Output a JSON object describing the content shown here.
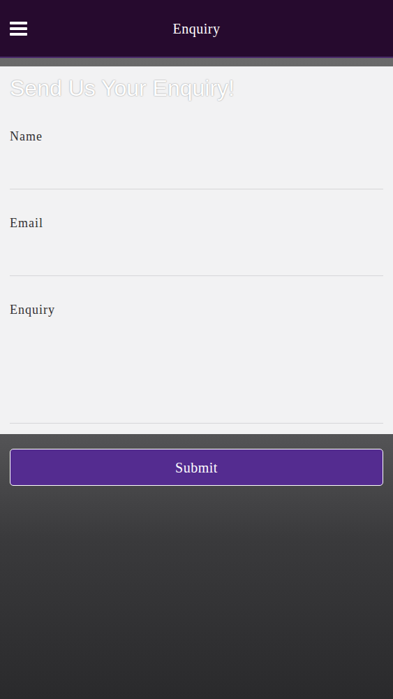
{
  "header": {
    "title": "Enquiry"
  },
  "form": {
    "heading": "Send Us Your Enquiry!",
    "fields": [
      {
        "label": "Name",
        "kind": "input"
      },
      {
        "label": "Email",
        "kind": "input"
      },
      {
        "label": "Enquiry",
        "kind": "textarea"
      }
    ],
    "submit": "Submit"
  }
}
